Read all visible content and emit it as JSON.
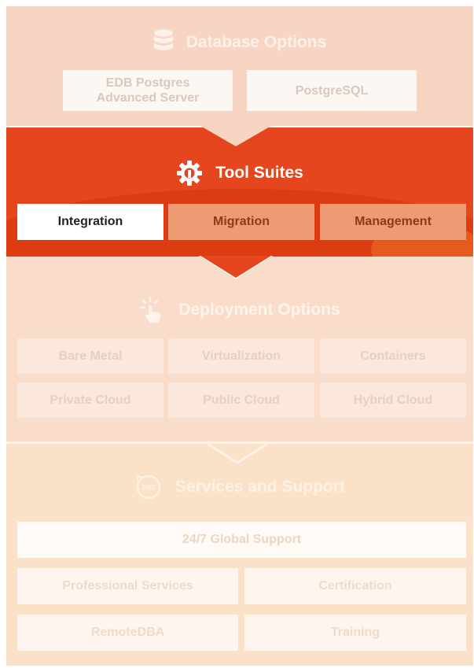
{
  "database_options": {
    "title": "Database Options",
    "icon": "database-icon",
    "items": [
      {
        "lines": [
          "EDB Postgres",
          "Advanced Server"
        ]
      },
      {
        "label": "PostgreSQL"
      }
    ]
  },
  "tool_suites": {
    "title": "Tool Suites",
    "icon": "gear-icon",
    "items": [
      {
        "label": "Integration",
        "active": true
      },
      {
        "label": "Migration",
        "active": false
      },
      {
        "label": "Management",
        "active": false
      }
    ]
  },
  "deployment_options": {
    "title": "Deployment Options",
    "icon": "tap-hand-icon",
    "items": [
      "Bare Metal",
      "Virtualization",
      "Containers",
      "Private Cloud",
      "Public Cloud",
      "Hybrid Cloud"
    ]
  },
  "services_support": {
    "title": "Services and Support",
    "icon": "clock-24-7-icon",
    "icon_text": "24/7",
    "items": [
      "24/7 Global Support",
      "Professional Services",
      "Certification",
      "RemoteDBA",
      "Training"
    ]
  },
  "colors": {
    "accent": "#e5461d",
    "db_background": "#f8d4c3",
    "deploy_background": "#fadccb",
    "services_background": "#fbe1c8"
  }
}
